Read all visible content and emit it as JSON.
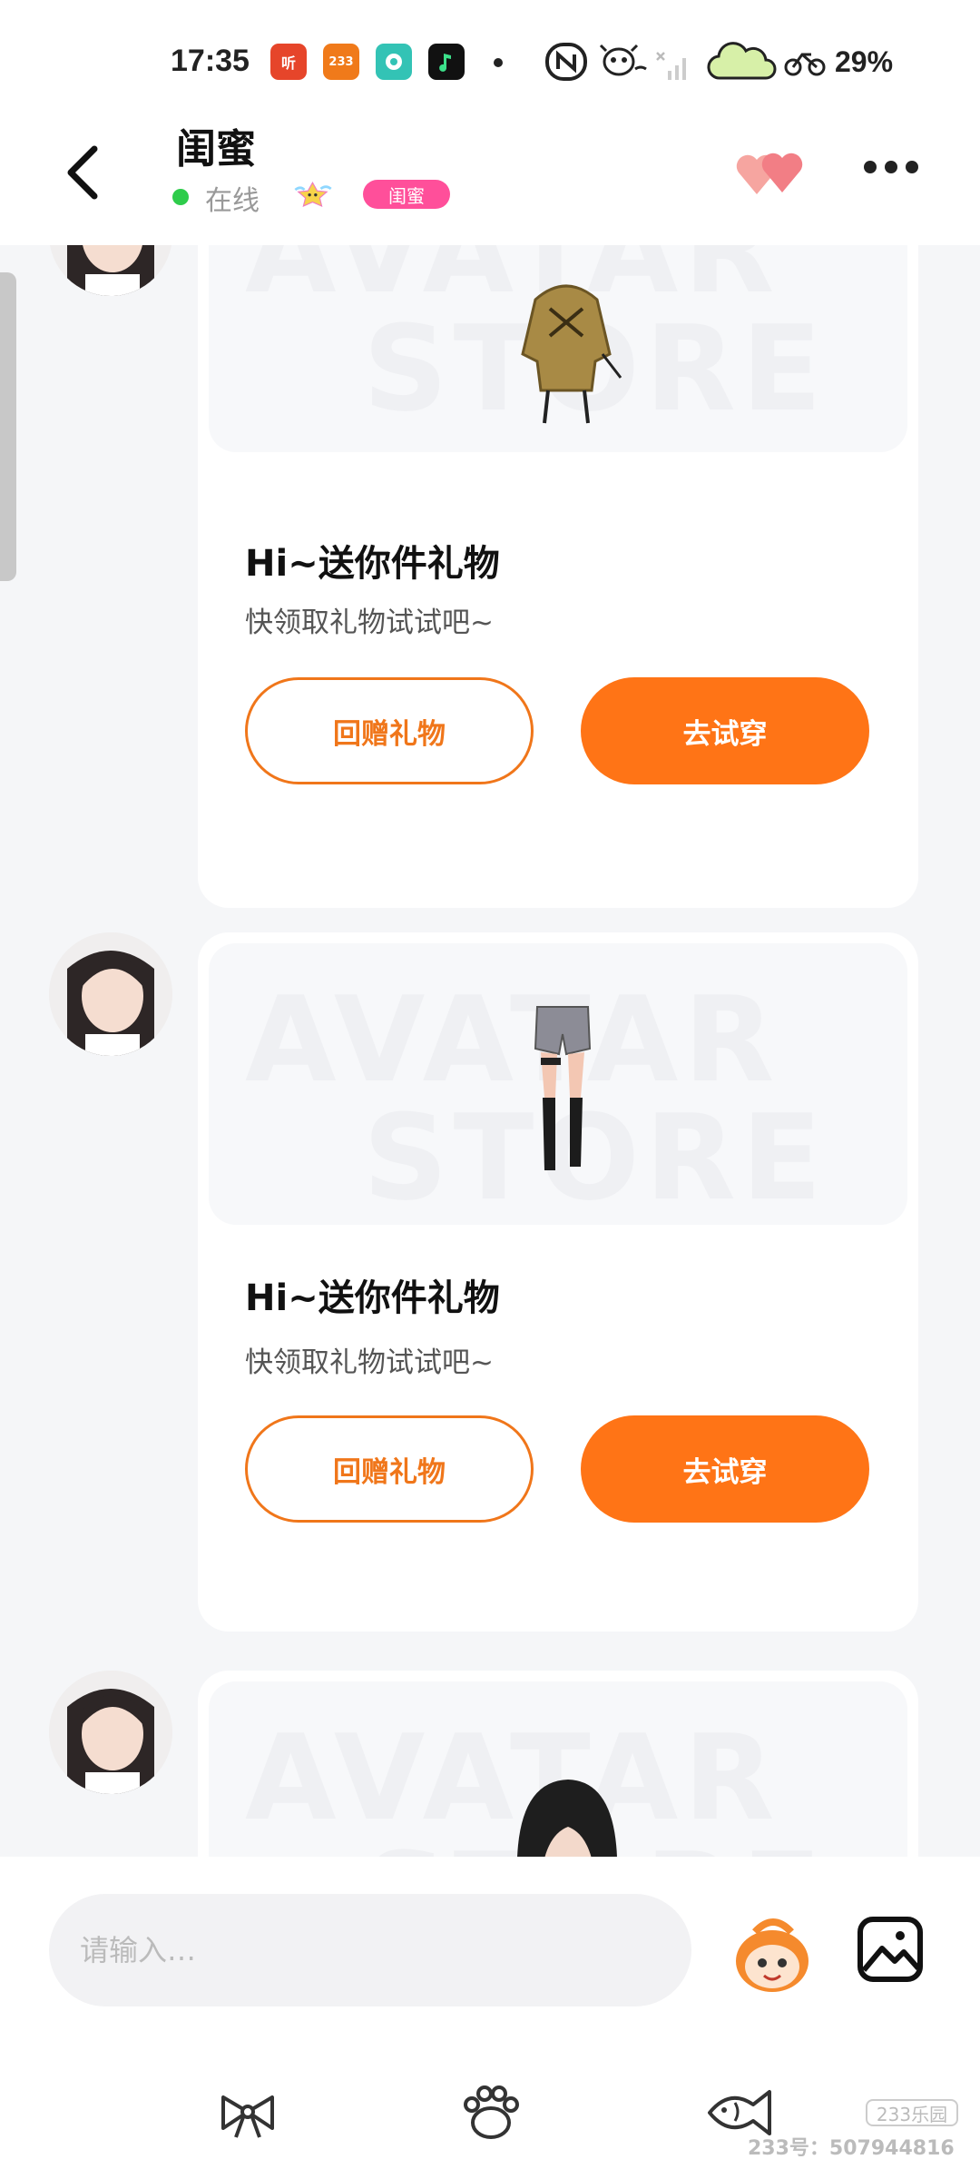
{
  "status_bar": {
    "time": "17:35",
    "app_icons": [
      {
        "name": "ting-app-icon",
        "label": "听",
        "color": "#e6452a"
      },
      {
        "name": "233-app-icon",
        "label": "233",
        "color": "#f07a1a"
      },
      {
        "name": "music-app-icon",
        "label": "",
        "color": "#33c3b5"
      },
      {
        "name": "qq-music-app-icon",
        "label": "",
        "color": "#111111"
      }
    ],
    "battery_percent": "29%"
  },
  "header": {
    "title": "闺蜜",
    "online_status": "在线",
    "badge_label": "闺蜜"
  },
  "messages": [
    {
      "watermark_top": "AVATAR",
      "watermark_bottom": "STORE",
      "item": "jacket",
      "title": "Hi~送你件礼物",
      "subtitle": "快领取礼物试试吧~",
      "return_label": "回赠礼物",
      "try_label": "去试穿"
    },
    {
      "watermark_top": "AVATAR",
      "watermark_bottom": "STORE",
      "item": "shorts-boots",
      "title": "Hi~送你件礼物",
      "subtitle": "快领取礼物试试吧~",
      "return_label": "回赠礼物",
      "try_label": "去试穿"
    },
    {
      "watermark_top": "AVATAR",
      "watermark_bottom": "STORE",
      "item": "hair"
    }
  ],
  "input": {
    "placeholder": "请输入…"
  },
  "footer": {
    "id_text": "233号：507944816",
    "brand": "233乐园"
  },
  "colors": {
    "accent": "#ff7416",
    "online": "#2ecc4b",
    "badge": "#ff4f9a"
  }
}
